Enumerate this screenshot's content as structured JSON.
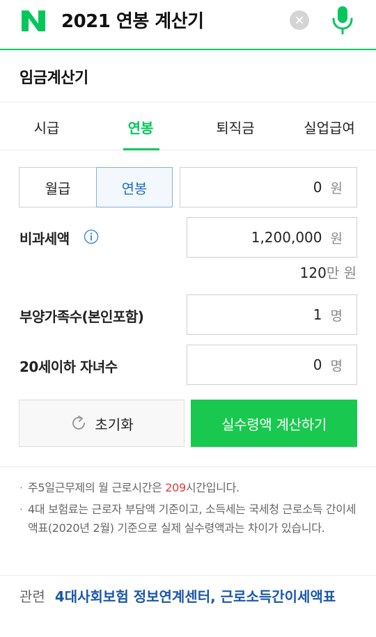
{
  "search": {
    "logo_letter": "N",
    "query": "2021 연봉 계산기"
  },
  "page_title": "임금계산기",
  "tabs": [
    {
      "label": "시급",
      "active": false
    },
    {
      "label": "연봉",
      "active": true
    },
    {
      "label": "퇴직금",
      "active": false
    },
    {
      "label": "실업급여",
      "active": false
    }
  ],
  "mode_toggle": {
    "monthly_label": "월급",
    "annual_label": "연봉",
    "selected": "연봉"
  },
  "salary": {
    "value": "0",
    "unit": "원"
  },
  "nontaxable": {
    "label": "비과세액",
    "value": "1,200,000",
    "unit": "원",
    "sub_value": "120",
    "sub_unit": "만 원"
  },
  "dependents": {
    "label": "부양가족수(본인포함)",
    "value": "1",
    "unit": "명"
  },
  "children": {
    "label": "20세이하 자녀수",
    "value": "0",
    "unit": "명"
  },
  "buttons": {
    "reset_label": "초기화",
    "calculate_label": "실수령액 계산하기"
  },
  "notes": {
    "note1_before": "주5일근무제의 월 근로시간은 ",
    "note1_highlight": "209",
    "note1_after": "시간입니다.",
    "note2": "4대 보험료는 근로자 부담액 기준이고, 소득세는 국세청 근로소득 간이세액표(2020년 2월) 기준으로 실제 실수령액과는 차이가 있습니다."
  },
  "related": {
    "label": "관련",
    "links": [
      "4대사회보험 정보연계센터",
      "근로소득간이세액표"
    ],
    "separator": ", "
  },
  "colors": {
    "brand_green": "#03c75a",
    "button_green": "#19c94f",
    "link_blue": "#1a57a8",
    "highlight_red": "#e43a3a"
  }
}
